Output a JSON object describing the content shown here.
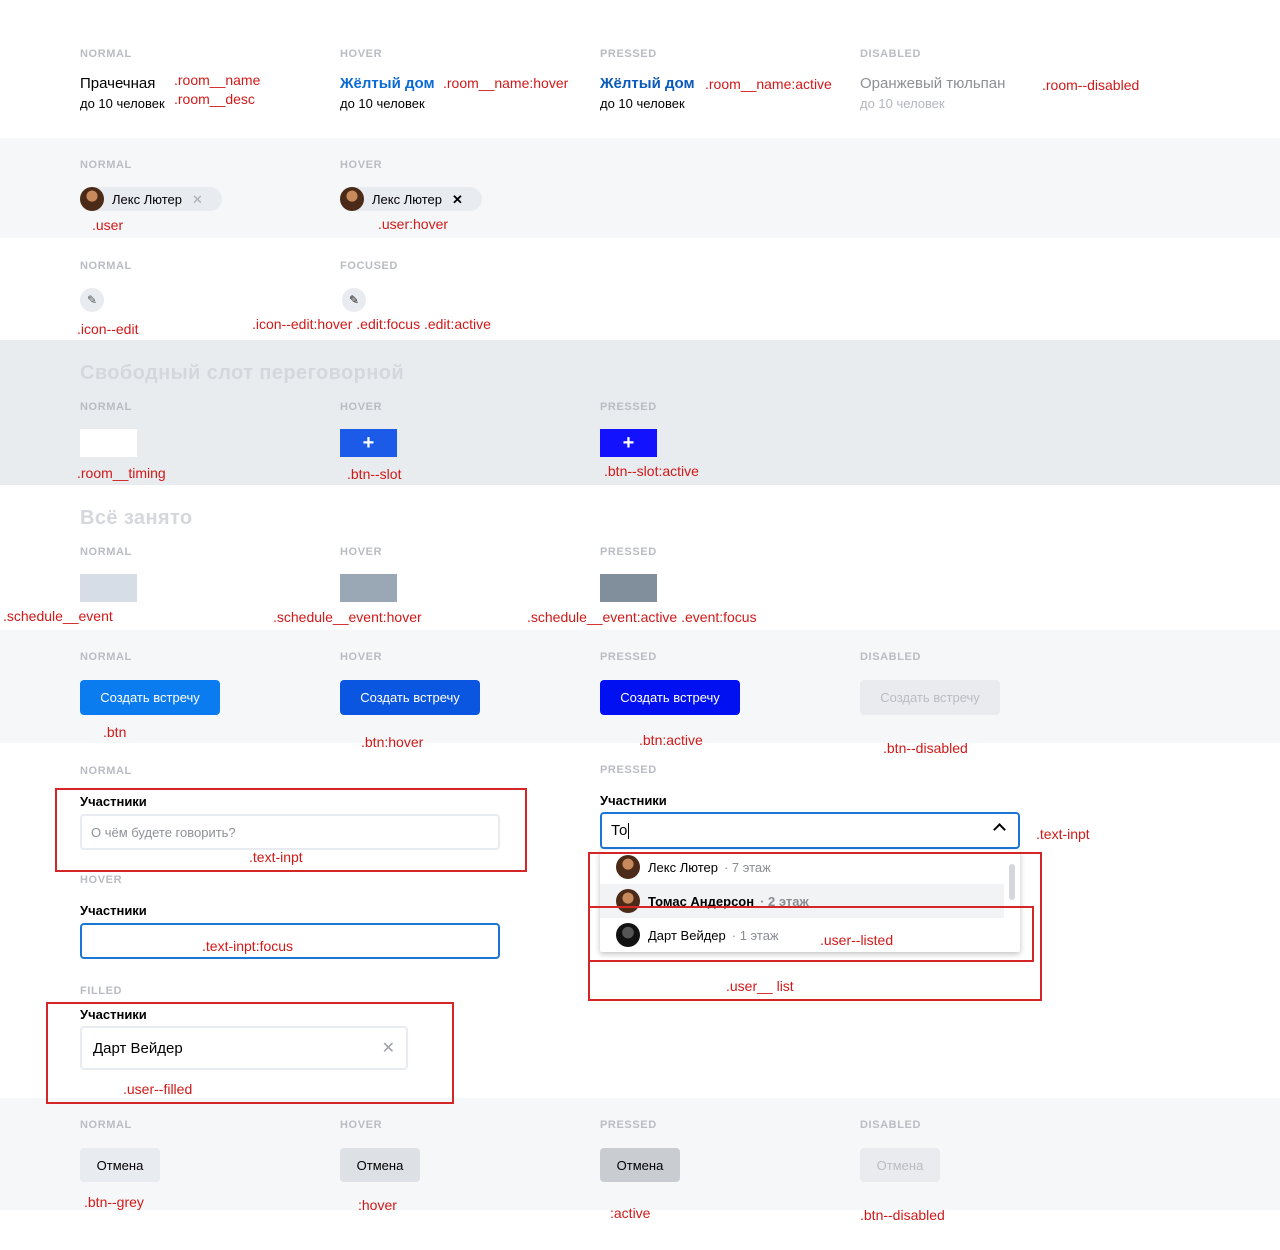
{
  "states": {
    "normal": "NORMAL",
    "hover": "HOVER",
    "pressed": "PRESSED",
    "disabled": "DISABLED",
    "focused": "FOCUSED",
    "filled": "FILLED"
  },
  "rooms": [
    {
      "name": "Прачечная",
      "desc": "до 10 человек"
    },
    {
      "name": "Жёлтый дом",
      "desc": "до 10 человек"
    },
    {
      "name": "Жёлтый дом",
      "desc": "до 10 человек"
    },
    {
      "name": "Оранжевый тюльпан",
      "desc": "до 10 человек"
    }
  ],
  "room_notes": {
    "name": ".room__name",
    "desc": ".room__desc",
    "hover": ".room__name:hover",
    "active": ".room__name:active",
    "disabled": ".room--disabled"
  },
  "user_chip": {
    "name": "Лекс Лютер",
    "close": "✕",
    "note_normal": ".user",
    "note_hover": ".user:hover"
  },
  "edit_icon": {
    "glyph": "✎",
    "note_normal": ".icon--edit",
    "note_focused": ".icon--edit:hover .edit:focus .edit:active"
  },
  "slot_section": {
    "title": "Свободный слот переговорной",
    "plus": "+",
    "note_normal": ".room__timing",
    "note_hover": ".btn--slot",
    "note_pressed": ".btn--slot:active"
  },
  "busy_section": {
    "title": "Всё занято",
    "note_normal": ".schedule__event",
    "note_hover": ".schedule__event:hover",
    "note_pressed": ".schedule__event:active .event:focus"
  },
  "create_btn": {
    "label": "Создать встречу",
    "note_normal": ".btn",
    "note_hover": ".btn:hover",
    "note_pressed": ".btn:active",
    "note_disabled": ".btn--disabled"
  },
  "participants": {
    "label": "Участники",
    "placeholder": "О чём будете говорить?",
    "typed": "То",
    "filled_value": "Дарт Вейдер",
    "clear": "✕",
    "note_normal": ".text-inpt",
    "note_focus": ".text-inpt:focus",
    "note_filled": ".user--filled",
    "note_pressed": ".text-inpt",
    "note_listed": ".user--listed",
    "note_list": ".user__ list",
    "options": [
      {
        "name": "Лекс Лютер",
        "floor": "· 7 этаж"
      },
      {
        "name": "Томас Андерсон",
        "floor": "· 2 этаж"
      },
      {
        "name": "Дарт Вейдер",
        "floor": "· 1 этаж"
      }
    ]
  },
  "cancel_btn": {
    "label": "Отмена",
    "note_normal": ".btn--grey",
    "note_hover": ":hover",
    "note_pressed": ":active",
    "note_disabled": ".btn--disabled"
  },
  "colors": {
    "accent": "#0070e0",
    "hover_blue": "#0b56e0",
    "pressed_blue": "#0010ff",
    "note_red": "#d01919"
  }
}
